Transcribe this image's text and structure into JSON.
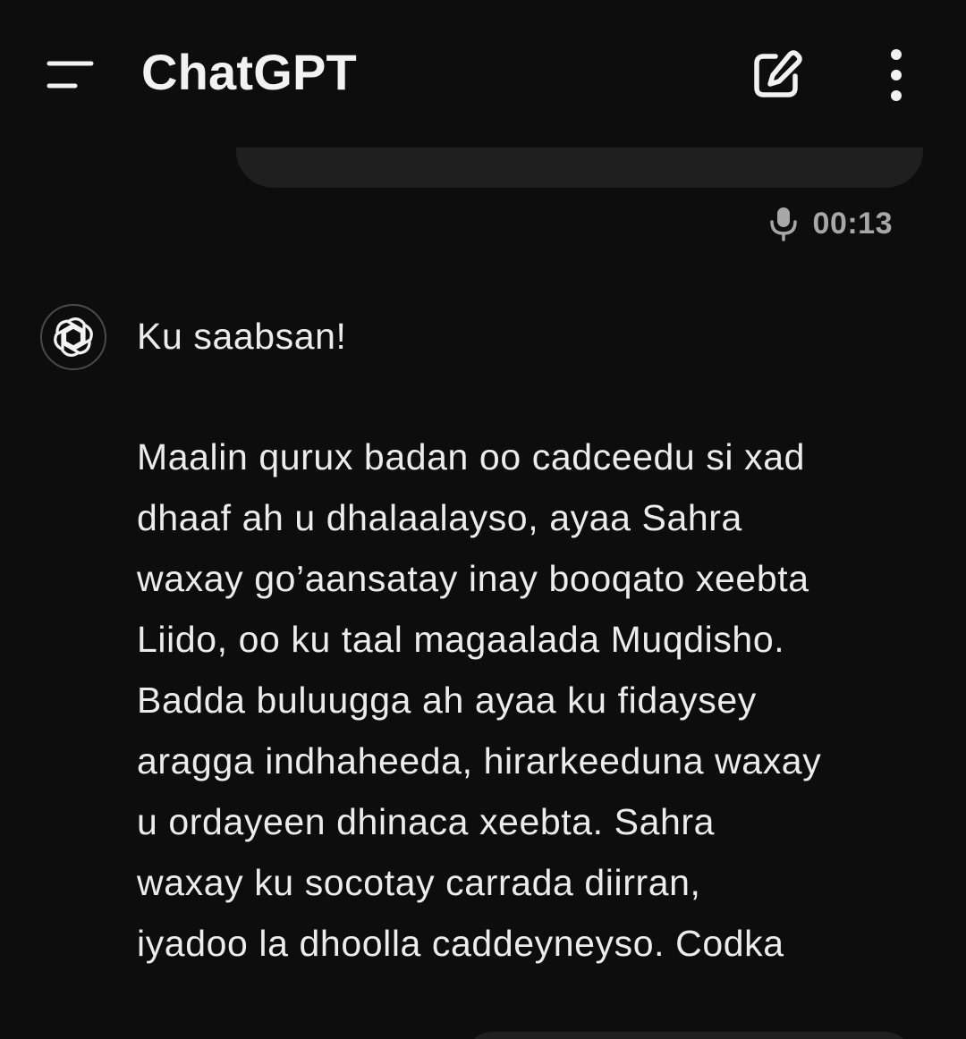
{
  "header": {
    "title": "ChatGPT",
    "icons": {
      "menu": "menu-lines-icon",
      "new_chat": "edit-pencil-icon",
      "more": "more-vertical-icon"
    }
  },
  "user_message": {
    "voice_duration": "00:13",
    "voice_icon": "microphone-icon"
  },
  "assistant_message": {
    "avatar_icon": "openai-logo-icon",
    "greeting": "Ku saabsan!",
    "lines": [
      "Maalin qurux badan oo cadceedu si xad",
      "dhaaf ah u dhalaalayso, ayaa Sahra",
      "waxay go’aansatay inay booqato xeebta",
      "Liido, oo ku taal magaalada Muqdisho.",
      "Badda buluugga ah ayaa ku fidaysey",
      "aragga indhaheeda, hirarkeeduna waxay",
      "u ordayeen dhinaca xeebta. Sahra",
      "waxay ku socotay carrada diirran,",
      "iyadoo la dhoolla caddeyneyso. Codka"
    ]
  },
  "colors": {
    "background": "#0d0d0d",
    "bubble": "#1f1f1f",
    "text": "#ececec",
    "muted": "#a7a7a7"
  }
}
